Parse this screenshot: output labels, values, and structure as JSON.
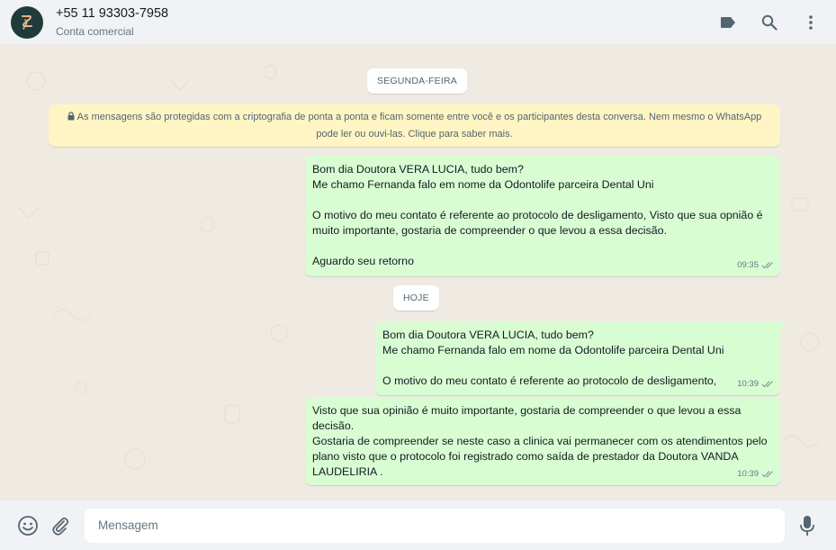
{
  "header": {
    "contact_name": "+55 11 93303-7958",
    "contact_subtitle": "Conta comercial",
    "icons": [
      "label-icon",
      "search-icon",
      "menu-icon"
    ]
  },
  "chat": {
    "day_labels": [
      "SEGUNDA-FEIRA",
      "HOJE"
    ],
    "encryption_notice": "As mensagens são protegidas com a criptografia de ponta a ponta e ficam somente entre você e os participantes desta conversa. Nem mesmo o WhatsApp pode ler ou ouvi-las. Clique para saber mais.",
    "messages": [
      {
        "text": "Bom dia Doutora VERA LUCIA, tudo bem?\nMe chamo Fernanda falo em nome da Odontolife parceira Dental Uni\n\nO motivo do meu contato é referente ao protocolo de desligamento, Visto que sua opnião é muito importante, gostaria de compreender o que levou a essa decisão.\n\nAguardo seu retorno",
        "time": "09:35",
        "status": "read"
      },
      {
        "text": "Bom dia Doutora VERA LUCIA, tudo bem?\nMe chamo Fernanda falo em nome da Odontolife parceira Dental Uni\n\nO motivo do meu contato é referente ao protocolo de desligamento,",
        "time": "10:39",
        "status": "read"
      },
      {
        "text": "Visto que sua opinião é muito importante, gostaria de compreender o que levou a essa decisão.\nGostaria de compreender se neste caso a clinica vai permanecer com os atendimentos pelo plano visto que o protocolo foi registrado como saída de prestador da Doutora VANDA LAUDELIRIA .",
        "time": "10:39",
        "status": "read"
      }
    ]
  },
  "footer": {
    "input_placeholder": "Mensagem",
    "icons": [
      "emoji-icon",
      "attach-icon",
      "mic-icon"
    ]
  },
  "colors": {
    "chat_background": "#efeae2",
    "outgoing_bubble": "#d9fdd3",
    "notice_background": "#fff5c4",
    "bar_background": "#f0f2f5"
  }
}
